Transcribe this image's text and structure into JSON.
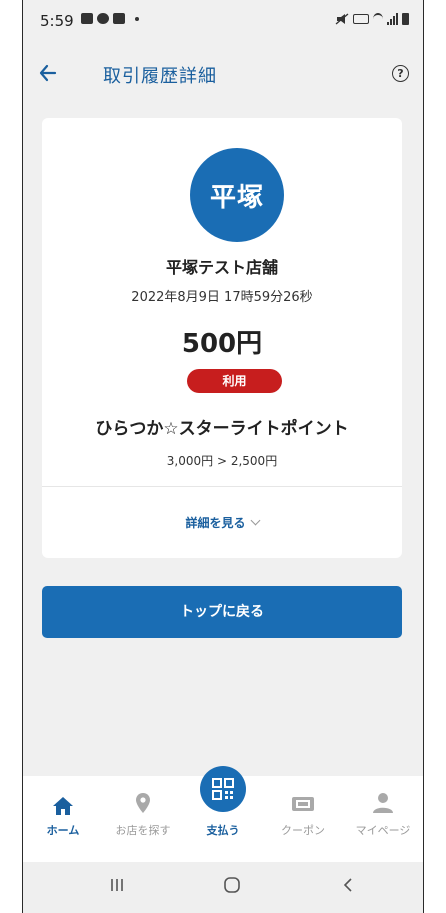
{
  "status_bar": {
    "time": "5:59"
  },
  "header": {
    "title": "取引履歴詳細"
  },
  "card": {
    "avatar_text": "平塚",
    "store_name": "平塚テスト店舗",
    "datetime": "2022年8月9日 17時59分26秒",
    "amount": "500円",
    "badge": "利用",
    "point_name": "ひらつか☆スターライトポイント",
    "balance_change": "3,000円 > 2,500円",
    "detail_link": "詳細を見る"
  },
  "top_button": "トップに戻る",
  "bottom_nav": {
    "items": [
      {
        "label": "ホーム",
        "icon": "home-icon",
        "active": true
      },
      {
        "label": "お店を探す",
        "icon": "map-pin-icon",
        "active": false
      },
      {
        "label": "支払う",
        "icon": "qr-code-icon",
        "active": false
      },
      {
        "label": "クーポン",
        "icon": "coupon-icon",
        "active": false
      },
      {
        "label": "マイページ",
        "icon": "person-icon",
        "active": false
      }
    ]
  },
  "colors": {
    "primary": "#1a6db4",
    "title_blue": "#1a5f9e",
    "badge_red": "#c71e1e",
    "background": "#f0f0f0"
  }
}
